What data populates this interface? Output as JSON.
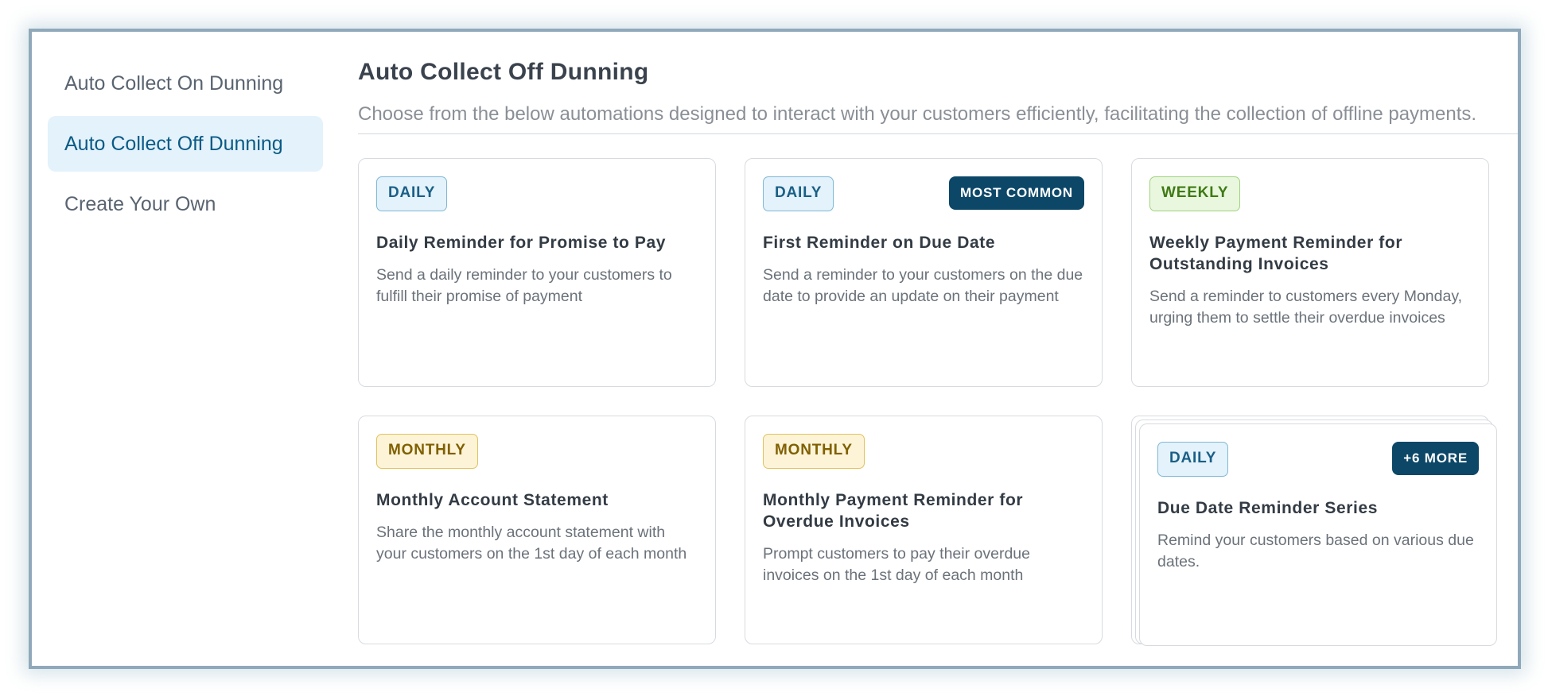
{
  "sidebar": {
    "items": [
      {
        "label": "Auto Collect On Dunning",
        "active": false
      },
      {
        "label": "Auto Collect Off Dunning",
        "active": true
      },
      {
        "label": "Create Your Own",
        "active": false
      }
    ]
  },
  "main": {
    "title": "Auto Collect Off Dunning",
    "subtitle": "Choose from the below automations designed to interact with your customers efficiently, facilitating the collection of offline payments."
  },
  "cards": [
    {
      "tag": "DAILY",
      "tag_type": "daily",
      "title": "Daily Reminder for Promise to Pay",
      "description": "Send a daily reminder to your customers to fulfill their promise of payment"
    },
    {
      "tag": "DAILY",
      "tag_type": "daily",
      "badge": "MOST COMMON",
      "title": "First Reminder on Due Date",
      "description": "Send a reminder to your customers on the due date to provide an update on their payment"
    },
    {
      "tag": "WEEKLY",
      "tag_type": "weekly",
      "title": "Weekly Payment Reminder for Outstanding Invoices",
      "description": "Send a reminder to customers every Monday, urging them to settle their overdue invoices"
    },
    {
      "tag": "MONTHLY",
      "tag_type": "monthly",
      "title": "Monthly Account Statement",
      "description": "Share the monthly account statement with your customers on the 1st day of each month"
    },
    {
      "tag": "MONTHLY",
      "tag_type": "monthly",
      "title": "Monthly Payment Reminder for Overdue Invoices",
      "description": "Prompt customers to pay their overdue invoices on the 1st day of each month"
    },
    {
      "tag": "DAILY",
      "tag_type": "daily",
      "badge": "+6 MORE",
      "title": "Due Date Reminder Series",
      "description": "Remind your customers based on various due dates."
    }
  ],
  "colors": {
    "accent": "#0c4768",
    "active_bg": "#e3f2fb",
    "active_text": "#0a5a85",
    "frame_border": "#8fa9ba"
  }
}
